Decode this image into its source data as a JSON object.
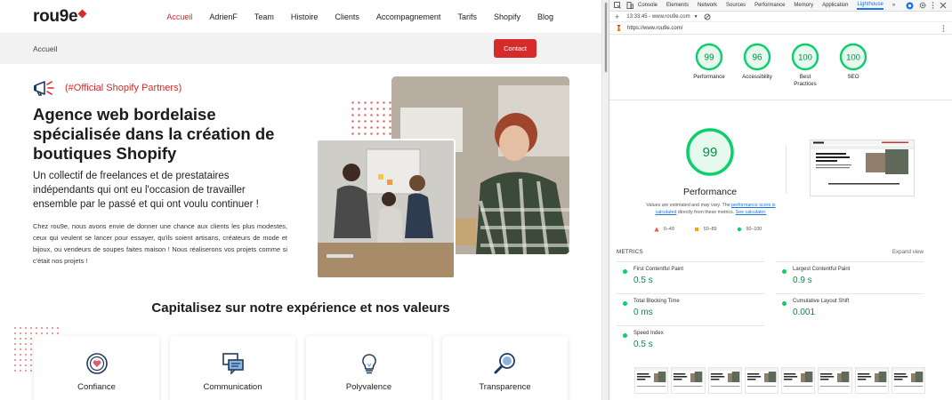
{
  "site": {
    "logo": "rou9e",
    "nav": [
      "Accueil",
      "AdrienF",
      "Team",
      "Histoire",
      "Clients",
      "Accompagnement",
      "Tarifs",
      "Shopify",
      "Blog"
    ],
    "breadcrumb": "Accueil",
    "contact_button": "Contact",
    "partner_tag": "(#Official Shopify Partners)",
    "heading": "Agence web bordelaise spécialisée dans la création de boutiques Shopify",
    "lead": "Un collectif de freelances et de prestataires indépendants qui ont eu l'occasion de travailler ensemble par le passé et qui ont voulu continuer !",
    "body": "Chez rou9e, nous avons envie de donner une chance aux clients les plus modestes, ceux qui veulent se lancer pour essayer, qu'ils soient artisans, créateurs de mode et bijoux, ou vendeurs de soupes faites maison ! Nous réaliserons vos projets comme si c'était nos projets !",
    "section_title": "Capitalisez sur notre expérience et nos valeurs",
    "values": [
      {
        "label": "Confiance",
        "icon": "heart-icon"
      },
      {
        "label": "Communication",
        "icon": "chat-icon"
      },
      {
        "label": "Polyvalence",
        "icon": "lightbulb-icon"
      },
      {
        "label": "Transparence",
        "icon": "magnifier-icon"
      }
    ]
  },
  "devtools": {
    "tabs": [
      "Console",
      "Elements",
      "Network",
      "Sources",
      "Performance",
      "Memory",
      "Application",
      "Lighthouse"
    ],
    "selected_tab": "Lighthouse",
    "more_tabs": "»",
    "report_time": "13:33:45 - www.rou9e.com",
    "url": "https://www.rou9e.com/",
    "scores": [
      {
        "label": "Performance",
        "value": "99"
      },
      {
        "label": "Accessibility",
        "value": "96"
      },
      {
        "label": "Best Practices",
        "value": "100"
      },
      {
        "label": "SEO",
        "value": "100"
      }
    ],
    "performance_score": "99",
    "performance_title": "Performance",
    "note_prefix": "Values are estimated and may vary. The ",
    "note_link1": "performance score is calculated",
    "note_mid": " directly from these metrics. ",
    "note_link2": "See calculator.",
    "legend": [
      "0–49",
      "50–89",
      "90–100"
    ],
    "metrics_title": "METRICS",
    "expand_view": "Expand view",
    "metrics": [
      {
        "name": "First Contentful Paint",
        "value": "0.5 s"
      },
      {
        "name": "Largest Contentful Paint",
        "value": "0.9 s"
      },
      {
        "name": "Total Blocking Time",
        "value": "0 ms"
      },
      {
        "name": "Cumulative Layout Shift",
        "value": "0.001"
      },
      {
        "name": "Speed Index",
        "value": "0.5 s"
      }
    ],
    "colors": {
      "pass": "#0cce6b",
      "average": "#ffa400",
      "fail": "#ff4e42",
      "link": "#1a73e8",
      "brand": "#d52b2b"
    }
  }
}
